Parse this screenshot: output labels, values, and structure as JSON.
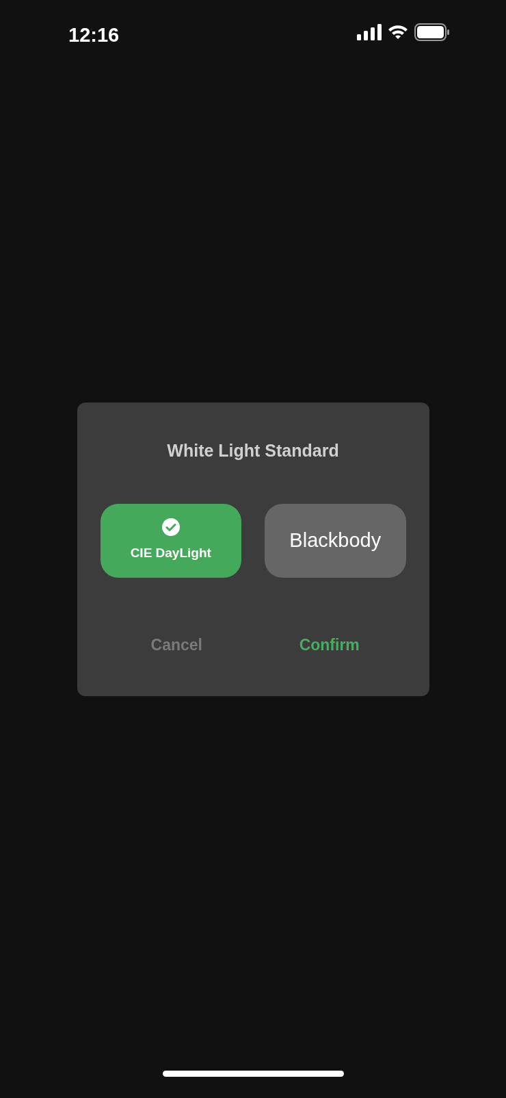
{
  "status_bar": {
    "time": "12:16"
  },
  "dialog": {
    "title": "White Light Standard",
    "options": [
      {
        "label": "CIE DayLight",
        "selected": true
      },
      {
        "label": "Blackbody",
        "selected": false
      }
    ],
    "buttons": [
      {
        "label": "Cancel",
        "kind": "cancel"
      },
      {
        "label": "Confirm",
        "kind": "confirm"
      }
    ]
  }
}
